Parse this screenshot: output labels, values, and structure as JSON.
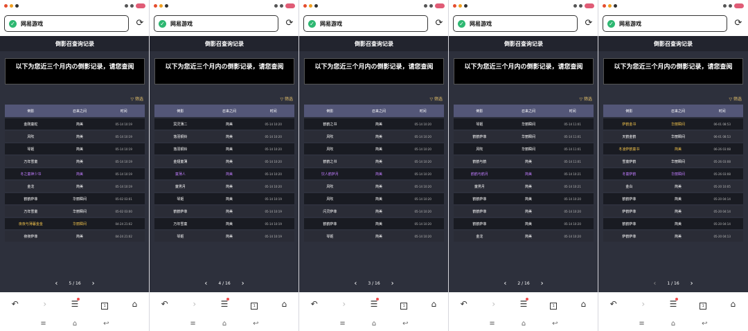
{
  "window_title": "网易游戏",
  "page_title": "倒影召查询记录",
  "notice": "以下为您近三个月内の倒影记录，请您查阅",
  "filter_label": "筛选",
  "columns": [
    "倒影",
    "召来之间",
    "时间"
  ],
  "panels": [
    {
      "page": "5 / 16",
      "rows": [
        {
          "name": "金刚童蛇",
          "type": "简美",
          "time": "05-14 10:19",
          "hl": ""
        },
        {
          "name": "风吹",
          "type": "简美",
          "time": "05-14 10:19",
          "hl": ""
        },
        {
          "name": "琴姬",
          "type": "简美",
          "time": "05-14 10:19",
          "hl": ""
        },
        {
          "name": "万年雪童",
          "type": "简美",
          "time": "05-14 10:19",
          "hl": ""
        },
        {
          "name": "冬之童神少书",
          "type": "简美",
          "time": "05-14 10:19",
          "hl": "purple"
        },
        {
          "name": "金龙",
          "type": "简美",
          "time": "05-14 10:19",
          "hl": ""
        },
        {
          "name": "鹤鹤萨菲",
          "type": "华丽瞬间",
          "time": "05-02 03:01",
          "hl": ""
        },
        {
          "name": "万年雪童",
          "type": "华丽瞬间",
          "time": "05-02 03:00",
          "hl": ""
        },
        {
          "name": "夜夜与薄暮金金",
          "type": "华丽瞬间",
          "time": "04-24 21:02",
          "hl": "gold"
        },
        {
          "name": "夜夜萨菲",
          "type": "简美",
          "time": "04-24 21:02",
          "hl": ""
        }
      ]
    },
    {
      "page": "4 / 16",
      "rows": [
        {
          "name": "冥灵薄二",
          "type": "简美",
          "time": "05-14 10:20",
          "hl": ""
        },
        {
          "name": "落羽铜铃",
          "type": "简美",
          "time": "05-14 10:20",
          "hl": ""
        },
        {
          "name": "落羽铜铃",
          "type": "简美",
          "time": "05-14 10:20",
          "hl": ""
        },
        {
          "name": "金翅童薄",
          "type": "简美",
          "time": "05-14 10:20",
          "hl": ""
        },
        {
          "name": "童薄人",
          "type": "简美",
          "time": "05-14 10:20",
          "hl": "purple"
        },
        {
          "name": "童男月",
          "type": "简美",
          "time": "05-14 10:20",
          "hl": ""
        },
        {
          "name": "琴姬",
          "type": "简美",
          "time": "05-14 10:19",
          "hl": ""
        },
        {
          "name": "鹤鹤萨菲",
          "type": "简美",
          "time": "05-14 10:19",
          "hl": ""
        },
        {
          "name": "万年雪童",
          "type": "简美",
          "time": "05-14 10:19",
          "hl": ""
        },
        {
          "name": "琴姬",
          "type": "简美",
          "time": "05-14 10:19",
          "hl": ""
        }
      ]
    },
    {
      "page": "3 / 16",
      "rows": [
        {
          "name": "鹤鹤之书",
          "type": "简美",
          "time": "05-14 10:20",
          "hl": ""
        },
        {
          "name": "风吹",
          "type": "简美",
          "time": "05-14 10:20",
          "hl": ""
        },
        {
          "name": "风吹",
          "type": "简美",
          "time": "05-14 10:20",
          "hl": ""
        },
        {
          "name": "鹤鹤之书",
          "type": "简美",
          "time": "05-14 10:20",
          "hl": ""
        },
        {
          "name": "饮人鹤萨月",
          "type": "简美",
          "time": "05-14 10:20",
          "hl": "purple"
        },
        {
          "name": "风吹",
          "type": "简美",
          "time": "05-14 10:20",
          "hl": ""
        },
        {
          "name": "风吹",
          "type": "简美",
          "time": "05-14 10:20",
          "hl": ""
        },
        {
          "name": "闪灵萨菲",
          "type": "简美",
          "time": "05-14 10:20",
          "hl": ""
        },
        {
          "name": "鹤鹤萨菲",
          "type": "简美",
          "time": "05-14 10:20",
          "hl": ""
        },
        {
          "name": "琴姬",
          "type": "简美",
          "time": "05-14 10:20",
          "hl": ""
        }
      ]
    },
    {
      "page": "2 / 16",
      "rows": [
        {
          "name": "琴姬",
          "type": "华丽瞬间",
          "time": "05-14 11:01",
          "hl": ""
        },
        {
          "name": "鹤鹤萨菲",
          "type": "华丽瞬间",
          "time": "05-14 11:01",
          "hl": ""
        },
        {
          "name": "风吹",
          "type": "华丽瞬间",
          "time": "05-14 11:01",
          "hl": ""
        },
        {
          "name": "鹤鹤与鹤",
          "type": "简美",
          "time": "05-14 11:01",
          "hl": ""
        },
        {
          "name": "鹤鹤与鹤月",
          "type": "简美",
          "time": "05-14 10:21",
          "hl": "purple"
        },
        {
          "name": "童男月",
          "type": "简美",
          "time": "05-14 10:21",
          "hl": ""
        },
        {
          "name": "鹤鹤萨菲",
          "type": "简美",
          "time": "05-14 10:20",
          "hl": ""
        },
        {
          "name": "鹤鹤萨菲",
          "type": "简美",
          "time": "05-14 10:20",
          "hl": ""
        },
        {
          "name": "鹤鹤萨菲",
          "type": "简美",
          "time": "05-14 10:20",
          "hl": ""
        },
        {
          "name": "金龙",
          "type": "简美",
          "time": "05-14 10:20",
          "hl": ""
        }
      ]
    },
    {
      "page": "1 / 16",
      "rows": [
        {
          "name": "萨鹤金书",
          "type": "华丽瞬间",
          "time": "06-01 08:53",
          "hl": "gold"
        },
        {
          "name": "天鹤金鹤",
          "type": "华丽瞬间",
          "time": "06-01 08:53",
          "hl": ""
        },
        {
          "name": "冬凌萨鹤童书",
          "type": "简美",
          "time": "06-26 03:08",
          "hl": "gold"
        },
        {
          "name": "雪童萨鹤",
          "type": "华丽瞬间",
          "time": "05-26 03:08",
          "hl": ""
        },
        {
          "name": "冬童萨鹤",
          "type": "华丽瞬间",
          "time": "05-26 03:08",
          "hl": "purple"
        },
        {
          "name": "金白",
          "type": "简美",
          "time": "05-20 10:05",
          "hl": ""
        },
        {
          "name": "鹤鹤萨菲",
          "type": "简美",
          "time": "05-20 04:14",
          "hl": ""
        },
        {
          "name": "萨鹤萨菲",
          "type": "简美",
          "time": "05-20 04:14",
          "hl": ""
        },
        {
          "name": "鹤鹤萨菲",
          "type": "简美",
          "time": "05-20 04:14",
          "hl": ""
        },
        {
          "name": "萨鹤萨菲",
          "type": "简美",
          "time": "05-20 04:13",
          "hl": ""
        }
      ]
    }
  ]
}
